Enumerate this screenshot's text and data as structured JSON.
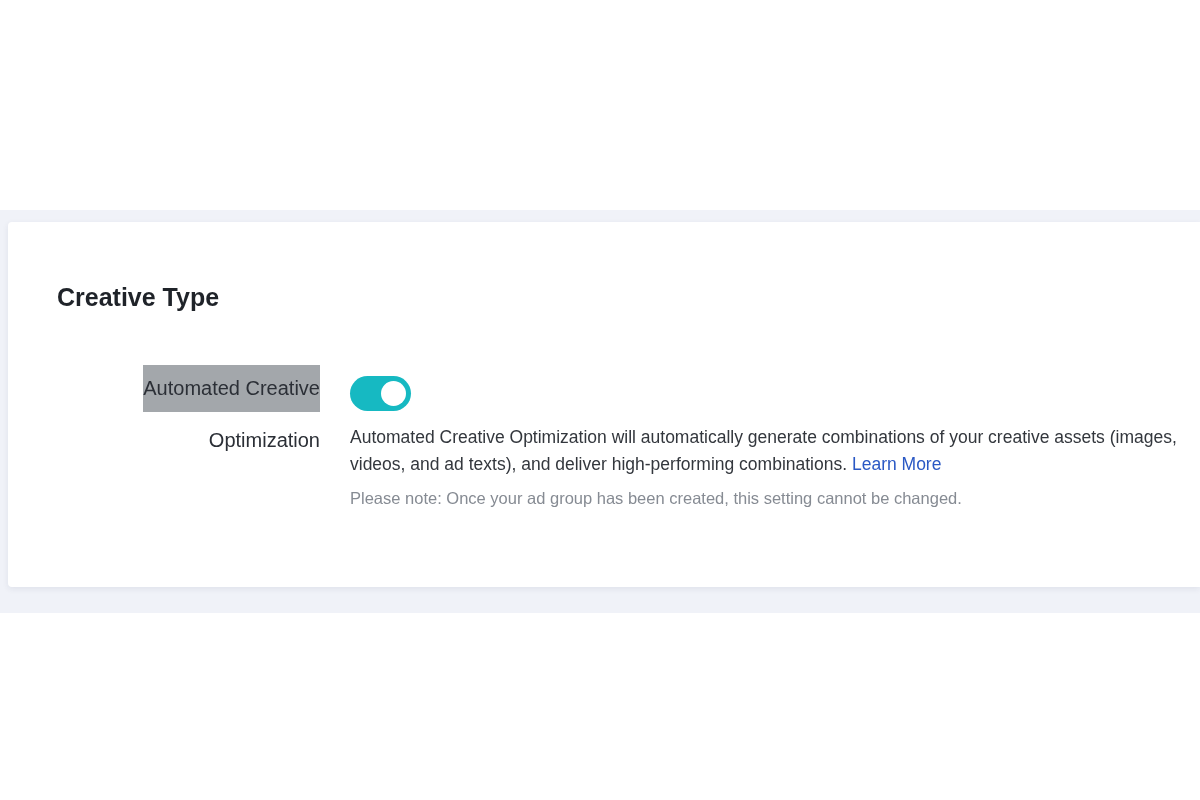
{
  "section": {
    "title": "Creative Type",
    "setting": {
      "label_lines": [
        {
          "text": "Automated Creative",
          "highlighted": true
        },
        {
          "text": "Optimization",
          "highlighted": false
        }
      ],
      "on": true,
      "description": {
        "text": "Automated Creative Optimization will automatically generate combinations of your creative assets (images, videos, and ad texts), and deliver high-performing combinations.",
        "link": "Learn More"
      },
      "note": "Please note: Once your ad group has been created, this setting cannot be changed."
    }
  }
}
